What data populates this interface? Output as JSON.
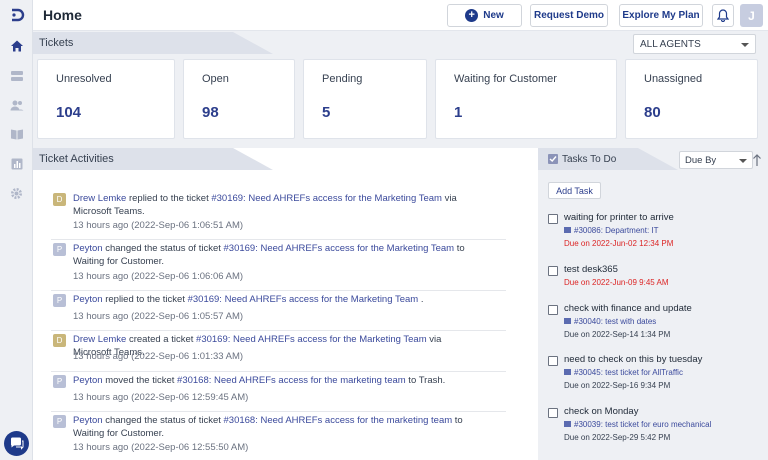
{
  "header": {
    "title": "Home",
    "new_label": "New",
    "request_demo_label": "Request Demo",
    "explore_label": "Explore My Plan",
    "avatar_initial": "J"
  },
  "tickets": {
    "section_title": "Tickets",
    "agent_filter": "ALL AGENTS",
    "stats": [
      {
        "label": "Unresolved",
        "value": "104"
      },
      {
        "label": "Open",
        "value": "98"
      },
      {
        "label": "Pending",
        "value": "5"
      },
      {
        "label": "Waiting for Customer",
        "value": "1"
      },
      {
        "label": "Unassigned",
        "value": "80"
      }
    ]
  },
  "activities": {
    "section_title": "Ticket Activities",
    "items": [
      {
        "initial": "D",
        "user": "Drew Lemke",
        "action": " replied to the ticket ",
        "ticket": "#30169: Need AHREFs access for the Marketing Team",
        "suffix": " via Microsoft Teams.",
        "time": "13 hours ago (2022-Sep-06 1:06:51 AM)"
      },
      {
        "initial": "P",
        "user": "Peyton",
        "action": " changed the status of ticket ",
        "ticket": "#30169: Need AHREFs access for the Marketing Team",
        "suffix": " to Waiting for Customer.",
        "time": "13 hours ago (2022-Sep-06 1:06:06 AM)"
      },
      {
        "initial": "P",
        "user": "Peyton",
        "action": " replied to the ticket ",
        "ticket": "#30169: Need AHREFs access for the Marketing Team",
        "suffix": " .",
        "time": "13 hours ago (2022-Sep-06 1:05:57 AM)"
      },
      {
        "initial": "D",
        "user": "Drew Lemke",
        "action": " created a ticket ",
        "ticket": "#30169: Need AHREFs access for the Marketing Team",
        "suffix": " via Microsoft Teams.",
        "time": "13 hours ago (2022-Sep-06 1:01:33 AM)"
      },
      {
        "initial": "P",
        "user": "Peyton",
        "action": " moved the ticket ",
        "ticket": "#30168: Need AHREFs access for the marketing team",
        "suffix": " to Trash.",
        "time": "13 hours ago (2022-Sep-06 12:59:45 AM)"
      },
      {
        "initial": "P",
        "user": "Peyton",
        "action": " changed the status of ticket ",
        "ticket": "#30168: Need AHREFs access for the marketing team",
        "suffix": " to Waiting for Customer.",
        "time": "13 hours ago (2022-Sep-06 12:55:50 AM)"
      }
    ]
  },
  "tasks": {
    "section_title": "Tasks To Do",
    "sort_label": "Due By",
    "add_label": "Add Task",
    "items": [
      {
        "title": "waiting for printer to arrive",
        "ref": "#30086: Department: IT",
        "due": "Due on 2022-Jun-02 12:34 PM",
        "overdue": true
      },
      {
        "title": "test desk365",
        "ref": "",
        "due": "Due on 2022-Jun-09 9:45 AM",
        "overdue": true
      },
      {
        "title": "check with finance and update",
        "ref": "#30040: test with dates",
        "due": "Due on 2022-Sep-14 1:34 PM",
        "overdue": false
      },
      {
        "title": "need to check on this by tuesday",
        "ref": "#30045: test ticket for AllTraffic",
        "due": "Due on 2022-Sep-16 9:34 PM",
        "overdue": false
      },
      {
        "title": "check on Monday",
        "ref": "#30039: test ticket for euro mechanical",
        "due": "Due on 2022-Sep-29 5:42 PM",
        "overdue": false
      }
    ]
  },
  "colors": {
    "accent": "#2c3e8c",
    "overdue": "#dc2626",
    "avatar_d": "#c9b67a",
    "avatar_p": "#b8bfd6"
  }
}
